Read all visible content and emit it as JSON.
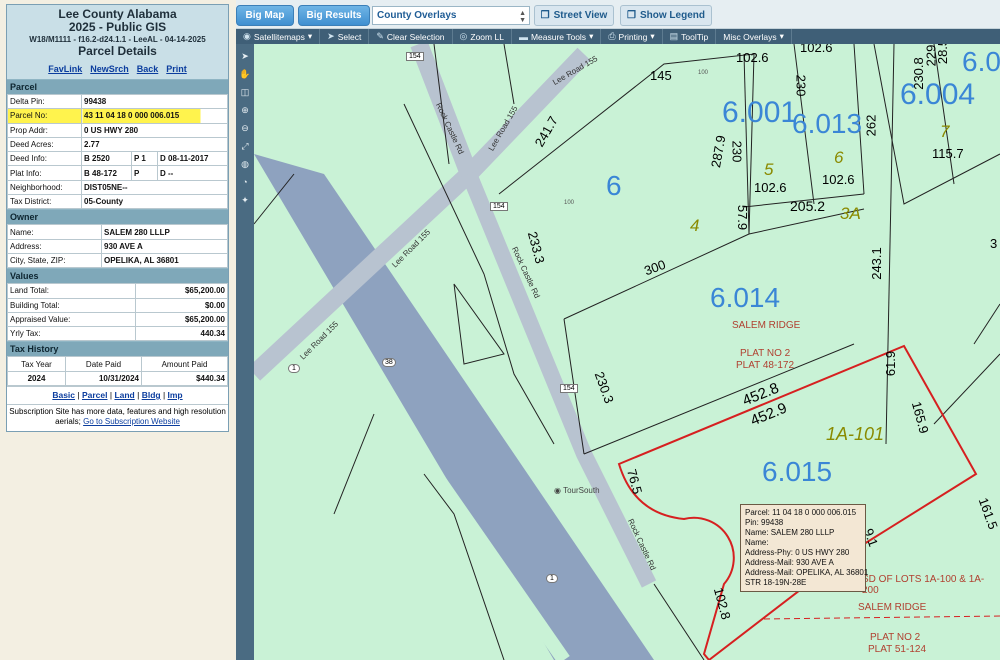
{
  "header": {
    "line1": "Lee County Alabama",
    "line2": "2025 - Public GIS",
    "line3": "W18/M1111 - f16.2-d24.1.1 - LeeAL - 04-14-2025",
    "line4": "Parcel Details"
  },
  "links": [
    "FavLink",
    "NewSrch",
    "Back",
    "Print"
  ],
  "parcel": {
    "title": "Parcel",
    "delta_pin_label": "Delta Pin:",
    "delta_pin": "99438",
    "parcel_no_label": "Parcel No:",
    "parcel_no": "43 11 04 18 0 000 006.015",
    "prop_addr_label": "Prop Addr:",
    "prop_addr": "0 US HWY 280",
    "deed_acres_label": "Deed Acres:",
    "deed_acres": "2.77",
    "deed_info_label": "Deed Info:",
    "deed_b": "B 2520",
    "deed_p": "P 1",
    "deed_d": "D 08-11-2017",
    "plat_info_label": "Plat Info:",
    "plat_b": "B 48-172",
    "plat_p": "P",
    "plat_d": "D --",
    "neighborhood_label": "Neighborhood:",
    "neighborhood": "DIST05NE--",
    "tax_district_label": "Tax District:",
    "tax_district": "05-County"
  },
  "owner": {
    "title": "Owner",
    "name_label": "Name:",
    "name": "SALEM 280 LLLP",
    "address_label": "Address:",
    "address": "930 AVE A",
    "city_label": "City, State, ZIP:",
    "city": "OPELIKA, AL 36801"
  },
  "values": {
    "title": "Values",
    "land_label": "Land Total:",
    "land": "$65,200.00",
    "building_label": "Building Total:",
    "building": "$0.00",
    "appraised_label": "Appraised Value:",
    "appraised": "$65,200.00",
    "tax_label": "Yrly Tax:",
    "tax": "440.34"
  },
  "tax_history": {
    "title": "Tax History",
    "col_year": "Tax Year",
    "col_date": "Date Paid",
    "col_amount": "Amount Paid",
    "year": "2024",
    "date": "10/31/2024",
    "amount": "$440.34"
  },
  "footer_links": [
    "Basic",
    "Parcel",
    "Land",
    "Bldg",
    "Imp"
  ],
  "subscription_text": "Subscription Site has more data, features and high resolution aerials;",
  "subscription_link": "Go to Subscription Website",
  "topbar": {
    "big_map": "Big Map",
    "big_results": "Big Results",
    "overlay_select": "County Overlays",
    "street_view": "Street View",
    "show_legend": "Show Legend"
  },
  "toolbar": {
    "satellite": "Satellitemaps",
    "select": "Select",
    "clear": "Clear Selection",
    "zoom": "Zoom LL",
    "measure": "Measure Tools",
    "printing": "Printing",
    "tooltip": "ToolTip",
    "misc": "Misc Overlays"
  },
  "map": {
    "parcels": [
      "6.001",
      "6.013",
      "6.004",
      "6",
      "6.014",
      "6.015",
      "6.0"
    ],
    "lots": [
      "5",
      "6",
      "7",
      "4",
      "3A",
      "1A-101"
    ],
    "dims": [
      "102.6",
      "230",
      "229",
      "102.6",
      "28.5",
      "230.8",
      "145",
      "287.9",
      "230",
      "262",
      "115.7",
      "241.7",
      "102.6",
      "102.6",
      "205.2",
      "57.9",
      "233.3",
      "300",
      "243.1",
      "230.3",
      "452.8",
      "452.9",
      "61.9",
      "165.9",
      "76.5",
      "102.8",
      "161.5",
      "9.1",
      "3"
    ],
    "roads": [
      "Lee Road 155",
      "Rock Castle Rd",
      "Lee Road 155",
      "Lee Road 155",
      "Rock Castle Rd",
      "Rock Castle Rd"
    ],
    "route_shields": [
      "154",
      "154",
      "154",
      "38",
      "1",
      "1"
    ],
    "small_labels": [
      "100",
      "100"
    ],
    "labels": {
      "salem1": "SALEM RIDGE",
      "plat1a": "PLAT NO 2",
      "plat1b": "PLAT 48-172",
      "resub": "SD OF LOTS 1A-100 & 1A-200",
      "salem2": "SALEM RIDGE",
      "plat2a": "PLAT NO 2",
      "plat2b": "PLAT 51-124",
      "poi": "TourSouth"
    }
  },
  "tooltip": [
    "Parcel: 11 04 18 0 000 006.015",
    "Pin: 99438",
    "Name: SALEM 280 LLLP",
    "Name:",
    "Address-Phy: 0 US HWY 280",
    "Address-Mail: 930 AVE A",
    "Address-Mail: OPELIKA, AL 36801",
    "STR 18-19N-28E"
  ],
  "colors": {
    "map_bg": "#c9f2d6",
    "highway": "#8ea2bf",
    "road": "#b8c3d0",
    "parcel_line": "#222222",
    "selected_parcel": "#d62020",
    "parcel_label": "#3a86d6",
    "lot_label": "#8a8a00"
  }
}
